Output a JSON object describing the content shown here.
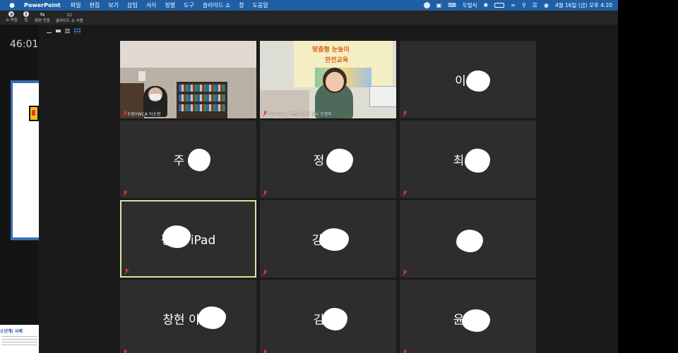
{
  "menubar": {
    "app": "PowerPoint",
    "menus": [
      "파일",
      "편집",
      "보기",
      "삽입",
      "서식",
      "정렬",
      "도구",
      "슬라이드 쇼",
      "창",
      "도움말"
    ],
    "status": {
      "input_method": "두벌식",
      "datetime": "4월 16일 (금) 오후 4:20"
    }
  },
  "toolbar": {
    "buttons": [
      {
        "label": "쇼 마침",
        "icon": "x-circle-icon"
      },
      {
        "label": "팁",
        "icon": "info-icon"
      },
      {
        "label": "화면 전환",
        "icon": "swap-icon"
      },
      {
        "label": "슬라이드 쇼 사용",
        "icon": "display-icon"
      }
    ]
  },
  "presenter": {
    "timer": "46:01",
    "note_title": "소년계| 사례"
  },
  "gallery": {
    "tiles": [
      {
        "name": "",
        "label": "수원YWCA 이소현",
        "video": true
      },
      {
        "name": "",
        "label": "수원YWCA 고등체 안전 강사 조영미",
        "video": true,
        "banner_line1": "맞춤형 눈높이",
        "banner_line2": "안전교육"
      },
      {
        "name": "이 현"
      },
      {
        "name": "주"
      },
      {
        "name": "정"
      },
      {
        "name": "최"
      },
      {
        "name": "정  의 iPad",
        "speaking": true
      },
      {
        "name": "강"
      },
      {
        "name": ""
      },
      {
        "name": "창현 이"
      },
      {
        "name": "김"
      },
      {
        "name": "윤"
      }
    ]
  },
  "colors": {
    "menubar_bg": "#1f5fa6",
    "tile_bg": "#2d2d2d",
    "speaking_border": "#d9e59b",
    "mic_muted": "#e23b3b"
  }
}
